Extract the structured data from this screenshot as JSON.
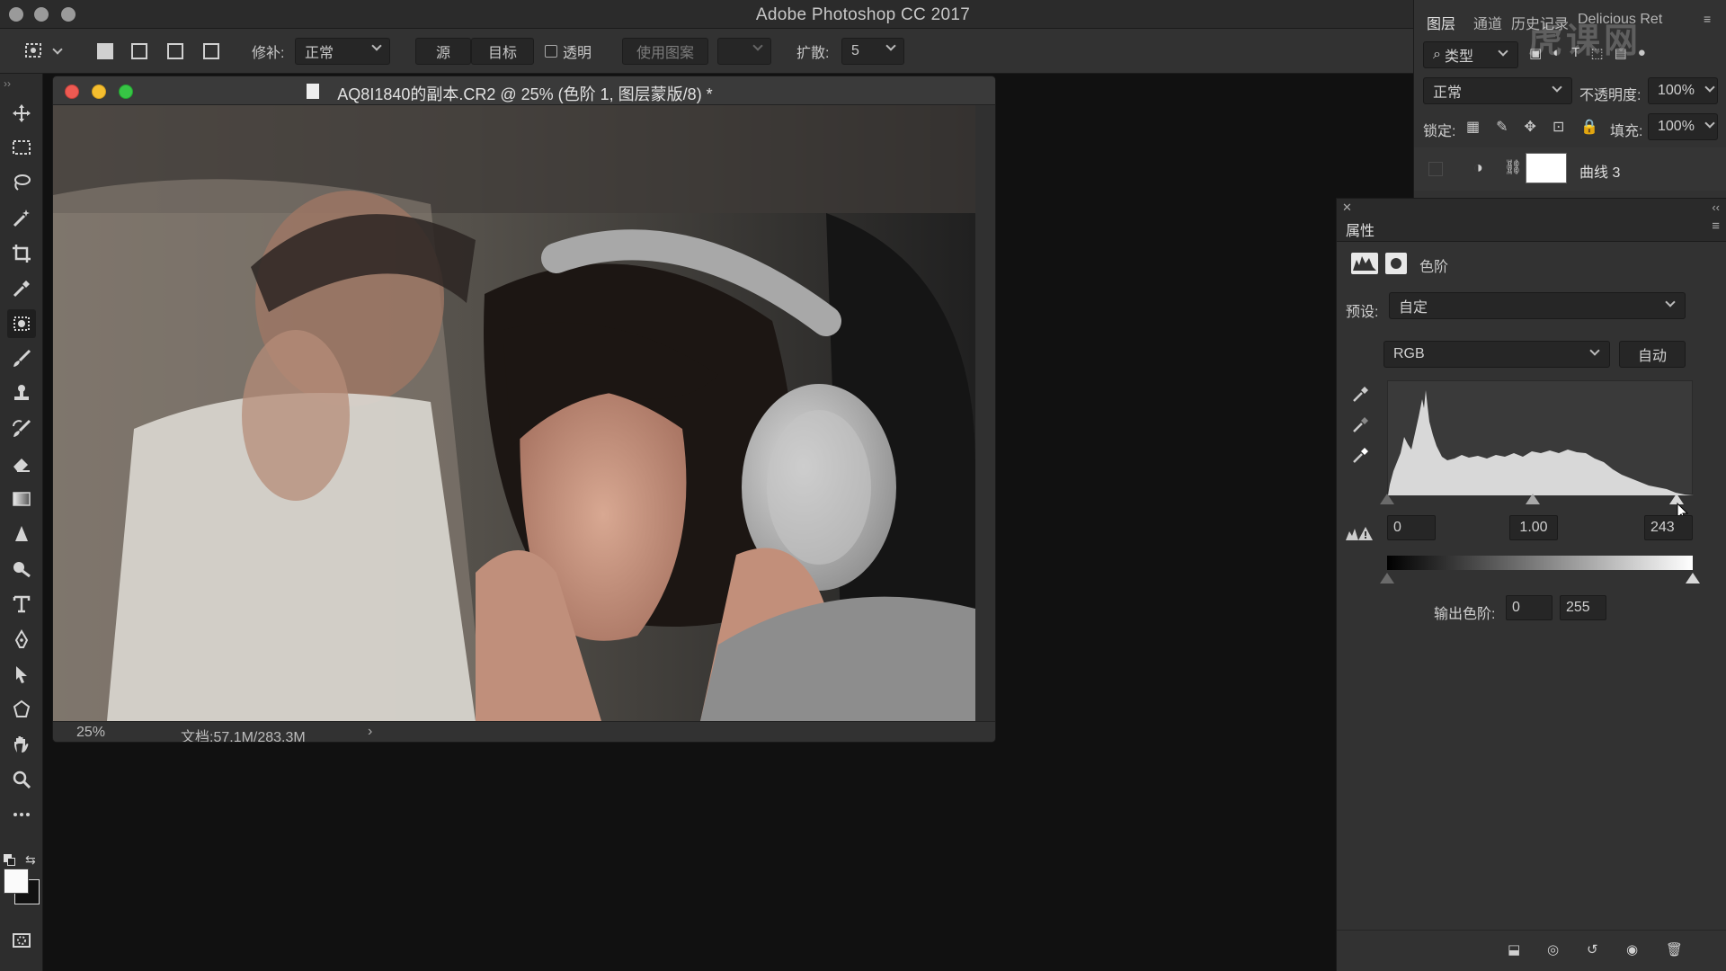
{
  "app": {
    "title": "Adobe Photoshop CC 2017"
  },
  "options_bar": {
    "patch_label": "修补:",
    "patch_mode": "正常",
    "source_button": "源",
    "target_button": "目标",
    "transparent_label": "透明",
    "use_pattern_button": "使用图案",
    "diffusion_label": "扩散:",
    "diffusion_value": "5"
  },
  "document": {
    "title": "AQ8I1840的副本.CR2 @ 25% (色阶 1, 图层蒙版/8) *",
    "zoom": "25%",
    "doc_info": "文档:57.1M/283.3M"
  },
  "layers_panel": {
    "tabs": [
      "图层",
      "通道",
      "历史记录",
      "Delicious Ret"
    ],
    "kind_filter": "类型",
    "blend_mode": "正常",
    "opacity_label": "不透明度:",
    "opacity_value": "100%",
    "lock_label": "锁定:",
    "fill_label": "填充:",
    "fill_value": "100%",
    "layer_name": "曲线 3"
  },
  "properties_panel": {
    "title": "属性",
    "adjustment_name": "色阶",
    "preset_label": "预设:",
    "preset_value": "自定",
    "channel": "RGB",
    "auto_button": "自动",
    "input_black": "0",
    "input_gamma": "1.00",
    "input_white": "243",
    "output_label": "输出色阶:",
    "output_black": "0",
    "output_white": "255"
  },
  "watermark": "虎课网",
  "icons": [
    "move-icon",
    "marquee-icon",
    "lasso-icon",
    "magic-wand-icon",
    "crop-icon",
    "eyedropper-icon",
    "patch-icon",
    "brush-icon",
    "stamp-icon",
    "history-brush-icon",
    "eraser-icon",
    "gradient-icon",
    "sharpen-icon",
    "dodge-icon",
    "type-icon",
    "pen-icon",
    "path-select-icon",
    "shape-icon",
    "hand-icon",
    "zoom-icon",
    "more-tools-icon"
  ]
}
